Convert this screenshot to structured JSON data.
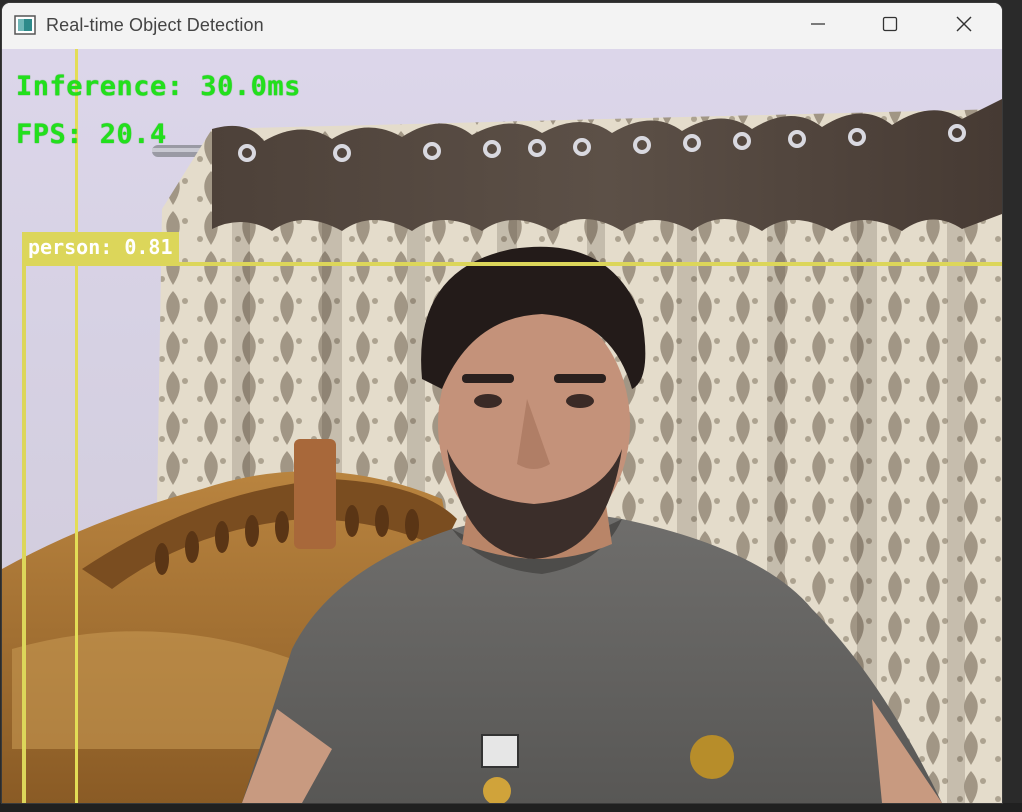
{
  "window": {
    "title": "Real-time Object Detection",
    "app_icon": "opencv-window-icon",
    "controls": {
      "minimize_icon": "minimize-icon",
      "maximize_icon": "maximize-icon",
      "close_icon": "close-icon"
    }
  },
  "overlay": {
    "inference_text": "Inference: 30.0ms",
    "fps_text": "FPS: 20.4",
    "text_color": "#22e01c"
  },
  "detection": {
    "label_text": "person: 0.81",
    "box_color": "#dcd65a"
  }
}
